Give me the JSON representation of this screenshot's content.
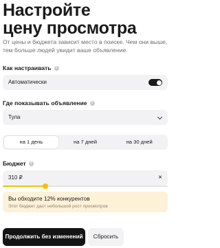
{
  "header": {
    "title_line1": "Настройте",
    "title_line2": "цену просмотра",
    "subtitle": "От цены и бюджета зависит место в поиске. Чем они выше, тем больше людей увидит ваше объявление."
  },
  "how_to_configure": {
    "label": "Как настраивать",
    "value": "Автоматически",
    "toggle_on": true
  },
  "placement": {
    "label": "Где показывать объявление",
    "value": "Тула"
  },
  "period": {
    "options": [
      "на 1 день",
      "на 7 дней",
      "на 30 дней"
    ],
    "selected_index": 0
  },
  "budget": {
    "label": "Бюджет",
    "value": "310 ₽",
    "clear_icon": "×",
    "slider_fraction": 0.26,
    "accent_color": "#f2c200"
  },
  "notice": {
    "headline": "Вы обходите 12% конкурентов",
    "detail": "Этот бюджет даст небольшой рост просмотров",
    "background": "#fdf1d8"
  },
  "actions": {
    "primary_label": "Продолжить без изменений",
    "secondary_label": "Сбросить"
  }
}
